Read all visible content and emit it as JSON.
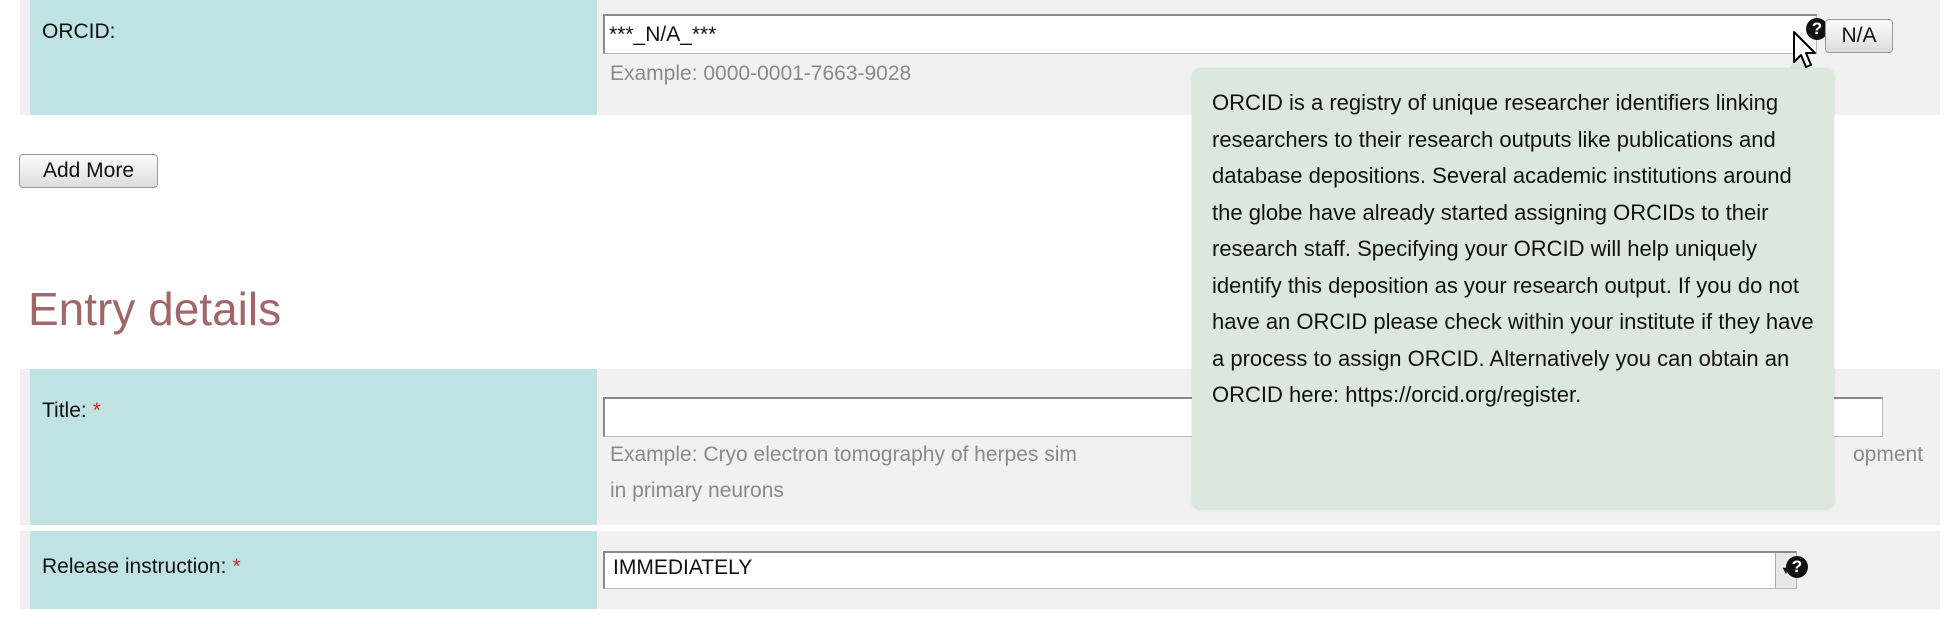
{
  "orcid": {
    "label": "ORCID:",
    "value": "***_N/A_***",
    "example": "Example: 0000-0001-7663-9028",
    "help_icon": "?",
    "na_button": "N/A"
  },
  "add_more_button": "Add More",
  "entry_details": {
    "title": "Entry details",
    "title_field": {
      "label": "Title:",
      "required_mark": "*",
      "value": "",
      "example_line1": "Example: Cryo electron tomography of herpes sim",
      "example_tail": "opment",
      "example_line2": "in primary neurons"
    },
    "release_instruction": {
      "label": "Release instruction:",
      "required_mark": "*",
      "selected": "IMMEDIATELY",
      "help_icon": "?"
    }
  },
  "tooltip": {
    "text": "ORCID is a registry of unique researcher identifiers linking researchers to their research outputs like publications and database depositions. Several academic institutions around the globe have already started assigning ORCIDs to their research staff. Specifying your ORCID will help uniquely identify this deposition as your research output. If you do not have an ORCID please check within your institute if they have a process to assign ORCID. Alternatively you can obtain an ORCID here: https://orcid.org/register."
  },
  "icons": {
    "help": "question-circle-icon",
    "select_arrow": "chevron-down-icon",
    "cursor": "mouse-pointer-icon"
  },
  "colors": {
    "label_bg": "#bfe3e3",
    "row_bg": "#f1f1f1",
    "section_title": "#a0676b",
    "tooltip_bg": "#dce8dc",
    "required": "#dd2222"
  }
}
